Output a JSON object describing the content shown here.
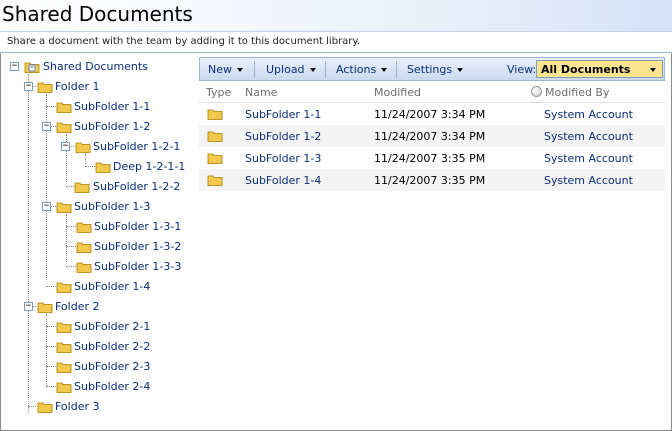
{
  "page": {
    "title": "Shared Documents",
    "description": "Share a document with the team by adding it to this document library."
  },
  "tree": {
    "root": "Shared Documents",
    "nodes": {
      "folder1": "Folder 1",
      "sf11": "SubFolder 1-1",
      "sf12": "SubFolder 1-2",
      "sf121": "SubFolder 1-2-1",
      "deep1211": "Deep 1-2-1-1",
      "sf122": "SubFolder 1-2-2",
      "sf13": "SubFolder 1-3",
      "sf131": "SubFolder 1-3-1",
      "sf132": "SubFolder 1-3-2",
      "sf133": "SubFolder 1-3-3",
      "sf14": "SubFolder 1-4",
      "folder2": "Folder 2",
      "sf21": "SubFolder 2-1",
      "sf22": "SubFolder 2-2",
      "sf23": "SubFolder 2-3",
      "sf24": "SubFolder 2-4",
      "folder3": "Folder 3"
    },
    "expander_minus": "−"
  },
  "toolbar": {
    "new_label": "New",
    "upload_label": "Upload",
    "actions_label": "Actions",
    "settings_label": "Settings",
    "view_label": "View:",
    "view_value": "All Documents"
  },
  "list": {
    "columns": {
      "type": "Type",
      "name": "Name",
      "modified": "Modified",
      "modified_by": "Modified By"
    },
    "rows": [
      {
        "name": "SubFolder 1-1",
        "modified": "11/24/2007 3:34 PM",
        "modified_by": "System Account"
      },
      {
        "name": "SubFolder 1-2",
        "modified": "11/24/2007 3:34 PM",
        "modified_by": "System Account"
      },
      {
        "name": "SubFolder 1-3",
        "modified": "11/24/2007 3:35 PM",
        "modified_by": "System Account"
      },
      {
        "name": "SubFolder 1-4",
        "modified": "11/24/2007 3:35 PM",
        "modified_by": "System Account"
      }
    ]
  },
  "colors": {
    "link": "#0a2d7a",
    "view_highlight": "#fde58f",
    "toolbar_top": "#e8f0fb",
    "toolbar_bottom": "#cbdaf0",
    "folder": "#f2c94c"
  },
  "icons": {
    "folder": "folder-icon",
    "library": "document-library-icon",
    "dropdown": "dropdown-arrow-icon",
    "presence": "presence-icon"
  }
}
